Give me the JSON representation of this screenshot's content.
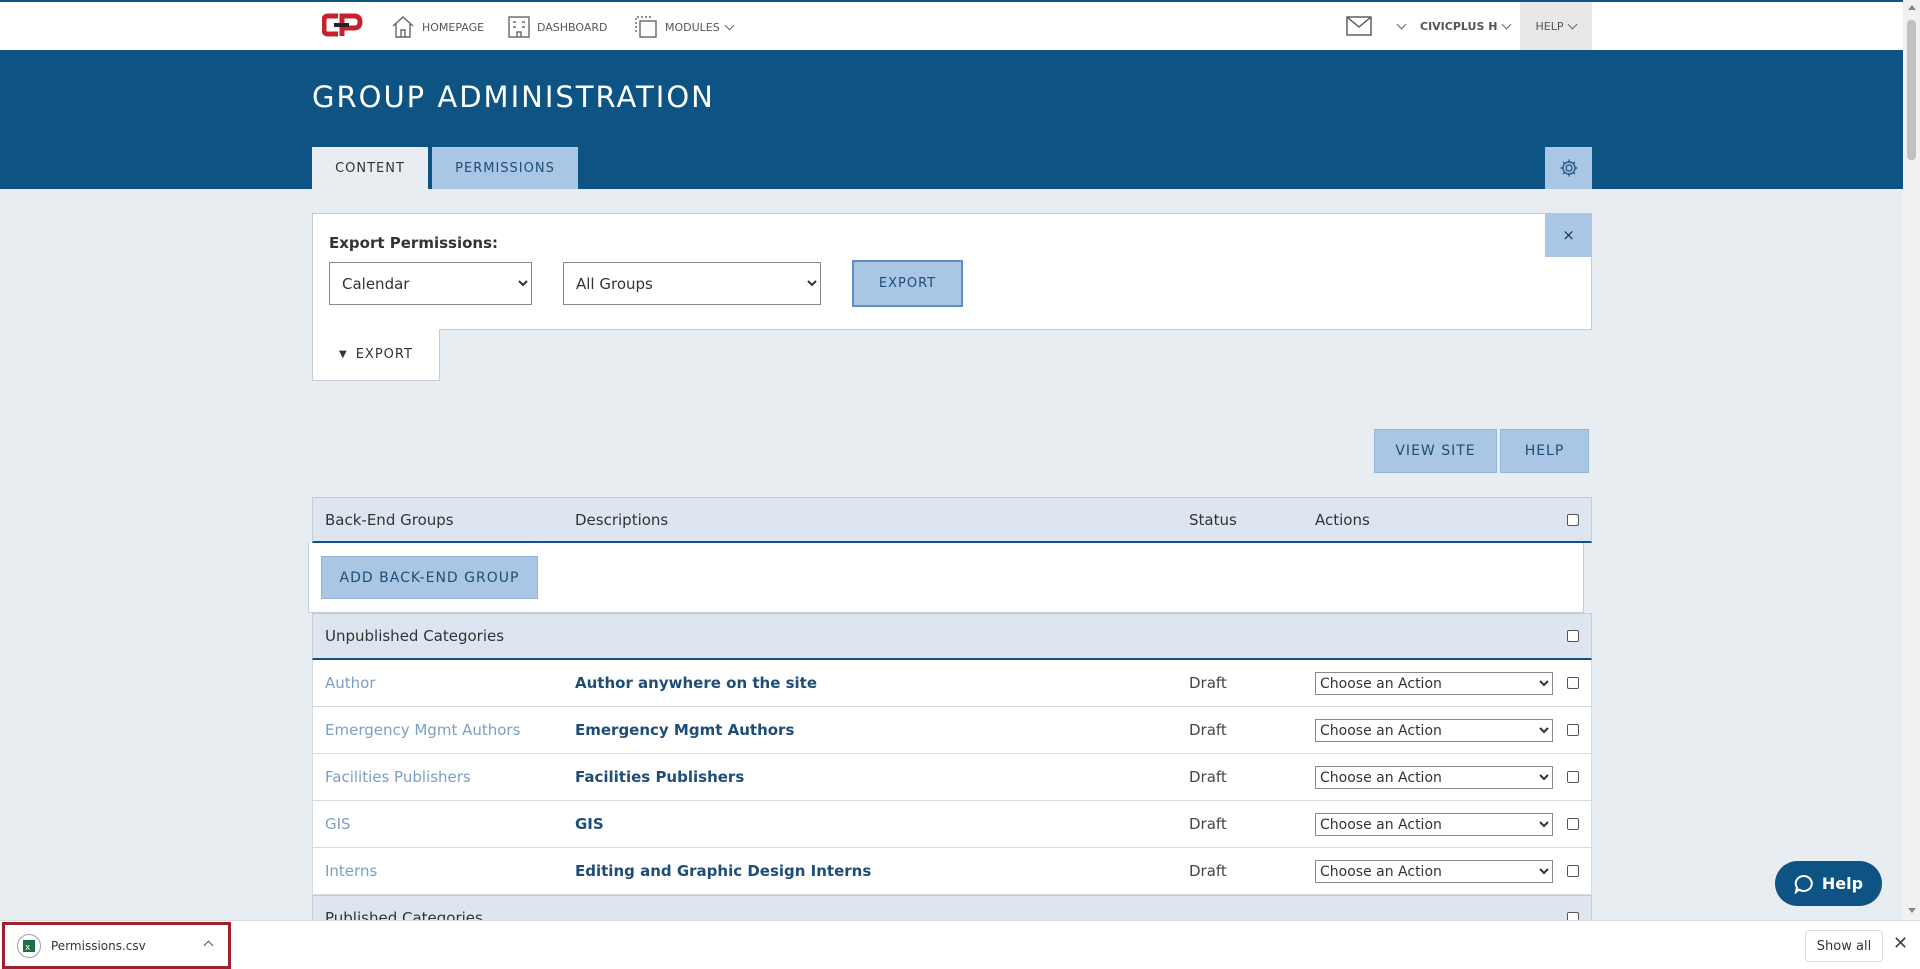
{
  "nav": {
    "homepage": "HOMEPAGE",
    "dashboard": "DASHBOARD",
    "modules": "MODULES",
    "user": "CIVICPLUS H",
    "help": "HELP"
  },
  "header": {
    "title": "GROUP ADMINISTRATION",
    "tabs": [
      {
        "label": "CONTENT",
        "active": true
      },
      {
        "label": "PERMISSIONS",
        "active": false
      }
    ]
  },
  "export_panel": {
    "label": "Export Permissions:",
    "module_selected": "Calendar",
    "group_selected": "All Groups",
    "export_button": "EXPORT",
    "close_symbol": "×",
    "toggle_label": "EXPORT"
  },
  "actions": {
    "view_site": "VIEW SITE",
    "help": "HELP"
  },
  "table": {
    "headers": [
      "Back-End Groups",
      "Descriptions",
      "Status",
      "Actions"
    ],
    "add_button": "ADD BACK-END GROUP",
    "unpublished_label": "Unpublished Categories",
    "published_label": "Published Categories",
    "rows": [
      {
        "name": "Author",
        "description": "Author anywhere on the site",
        "status": "Draft",
        "action": "Choose an Action"
      },
      {
        "name": "Emergency Mgmt Authors",
        "description": "Emergency Mgmt Authors",
        "status": "Draft",
        "action": "Choose an Action"
      },
      {
        "name": "Facilities Publishers",
        "description": "Facilities Publishers",
        "status": "Draft",
        "action": "Choose an Action"
      },
      {
        "name": "GIS",
        "description": "GIS",
        "status": "Draft",
        "action": "Choose an Action"
      },
      {
        "name": "Interns",
        "description": "Editing and Graphic Design Interns",
        "status": "Draft",
        "action": "Choose an Action"
      }
    ]
  },
  "help_fab": "Help",
  "download_bar": {
    "file_name": "Permissions.csv",
    "show_all": "Show all"
  },
  "colors": {
    "brand_blue": "#0d5384",
    "light_blue_button": "#a9c6e4",
    "page_bg": "#e8edf2",
    "logo_red": "#c8202e"
  }
}
